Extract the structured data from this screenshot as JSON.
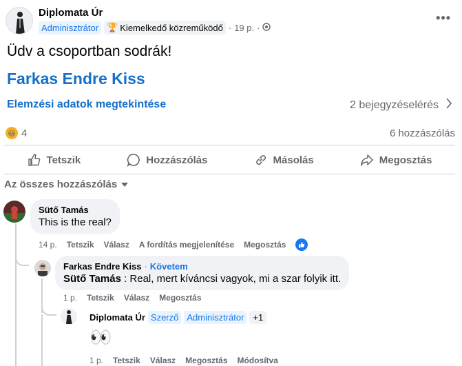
{
  "post": {
    "author": "Diplomata Úr",
    "badge_admin": "Adminisztrátor",
    "badge_contributor": "Kiemelkedő közreműködő",
    "time": "19 p.",
    "separator": "·",
    "text": "Üdv a csoportban sodrák!",
    "mention": "Farkas Endre Kiss",
    "insights_label": "Elemzési adatok megtekintése",
    "reach_label": "2 bejegyzéselérés",
    "reaction_count": "4",
    "comment_count": "6 hozzászólás",
    "more_icon": "more-horizontal-icon"
  },
  "actions": {
    "like": "Tetszik",
    "comment": "Hozzászólás",
    "copy": "Másolás",
    "share": "Megosztás"
  },
  "sort_label": "Az összes hozzászólás",
  "comments": [
    {
      "name": "Sütő Tamás",
      "text": "This is the real?",
      "time": "14 p.",
      "like": "Tetszik",
      "reply": "Válasz",
      "translate": "A fordítás megjelenítése",
      "share": "Megosztás"
    },
    {
      "name": "Farkas Endre Kiss",
      "dot": "·",
      "follow": "Követem",
      "mention": "Sütő Tamás",
      "text": " : Real, mert kíváncsi vagyok, mi a szar folyik itt.",
      "time": "1 p.",
      "like": "Tetszik",
      "reply": "Válasz",
      "share": "Megosztás"
    },
    {
      "name": "Diplomata Úr",
      "tag_author": "Szerző",
      "tag_admin": "Adminisztrátor",
      "tag_more": "+1",
      "text": "👀",
      "time": "1 p.",
      "like": "Tetszik",
      "reply": "Válasz",
      "share": "Megosztás",
      "edit": "Módosítva"
    }
  ],
  "colors": {
    "link": "#1670c9",
    "secondary_text": "#65676b",
    "bubble": "#f0f2f5",
    "like_blue": "#1877f2"
  }
}
